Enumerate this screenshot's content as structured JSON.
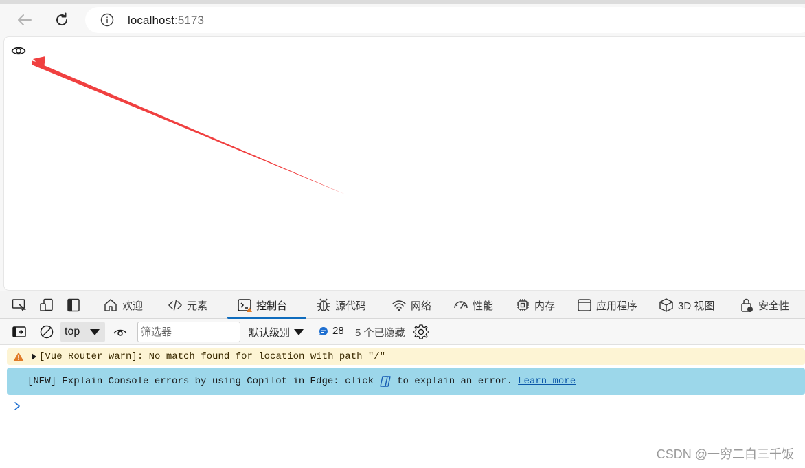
{
  "browser": {
    "url_host": "localhost",
    "url_port": ":5173"
  },
  "annotation": {
    "arrow_color": "#f04040"
  },
  "devtools": {
    "tabs": [
      {
        "label": "欢迎",
        "icon": "home-icon"
      },
      {
        "label": "元素",
        "icon": "code-icon"
      },
      {
        "label": "控制台",
        "icon": "console-icon",
        "active": true
      },
      {
        "label": "源代码",
        "icon": "bug-icon"
      },
      {
        "label": "网络",
        "icon": "wifi-icon"
      },
      {
        "label": "性能",
        "icon": "gauge-icon"
      },
      {
        "label": "内存",
        "icon": "chip-icon"
      },
      {
        "label": "应用程序",
        "icon": "window-icon"
      },
      {
        "label": "3D 视图",
        "icon": "cube-icon"
      },
      {
        "label": "安全性",
        "icon": "lock-icon"
      }
    ],
    "accent_color": "#0f6cbd"
  },
  "toolbar": {
    "context": "top",
    "filter_placeholder": "筛选器",
    "levels": "默认级别",
    "issues_count": "28",
    "hidden": "5 个已隐藏"
  },
  "console": {
    "warning": "[Vue Router warn]: No match found for location with path \"/\"",
    "info_before": "[NEW] Explain Console errors by using Copilot in Edge: click",
    "info_after": "to explain an error.",
    "info_link": "Learn more"
  },
  "watermark": "CSDN @一穷二白三千饭"
}
